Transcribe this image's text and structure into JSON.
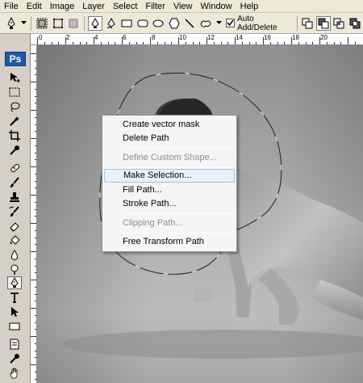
{
  "menubar": {
    "items": [
      "File",
      "Edit",
      "Image",
      "Layer",
      "Select",
      "Filter",
      "View",
      "Window",
      "Help"
    ]
  },
  "options_bar": {
    "icons": [
      "pen-tool-icon",
      "shape-layers-icon",
      "paths-icon",
      "fill-pixels-icon",
      "pen-icon",
      "freeform-pen-icon",
      "rectangle-icon",
      "rounded-rectangle-icon",
      "ellipse-icon",
      "polygon-icon",
      "line-icon",
      "custom-shape-icon"
    ],
    "auto_add_delete_label": "Auto Add/Delete",
    "auto_add_delete_checked": true
  },
  "toolbox": {
    "logo": "Ps",
    "tools": [
      "move-tool",
      "marquee-tool",
      "lasso-tool",
      "magic-wand-tool",
      "crop-tool",
      "eyedropper-tool",
      "healing-brush-tool",
      "brush-tool",
      "clone-stamp-tool",
      "history-brush-tool",
      "eraser-tool",
      "paint-bucket-tool",
      "blur-tool",
      "dodge-tool",
      "pen-tool",
      "type-tool",
      "path-selection-tool",
      "rectangle-shape-tool",
      "notes-tool",
      "eyedropper-tool-2",
      "hand-tool"
    ],
    "active_tool": "pen-tool"
  },
  "ruler": {
    "top_numbers": [
      "0",
      "2",
      "4",
      "6",
      "8",
      "10",
      "12",
      "14",
      "16",
      "18",
      "20"
    ]
  },
  "context_menu": {
    "items": [
      {
        "label": "Create vector mask",
        "enabled": true
      },
      {
        "label": "Delete Path",
        "enabled": true
      },
      {
        "label": "Define Custom Shape...",
        "enabled": false
      },
      {
        "label": "Make Selection...",
        "enabled": true,
        "highlighted": true
      },
      {
        "label": "Fill Path...",
        "enabled": true
      },
      {
        "label": "Stroke Path...",
        "enabled": true
      },
      {
        "label": "Clipping Path...",
        "enabled": false
      },
      {
        "label": "Free Transform Path",
        "enabled": true
      }
    ]
  }
}
